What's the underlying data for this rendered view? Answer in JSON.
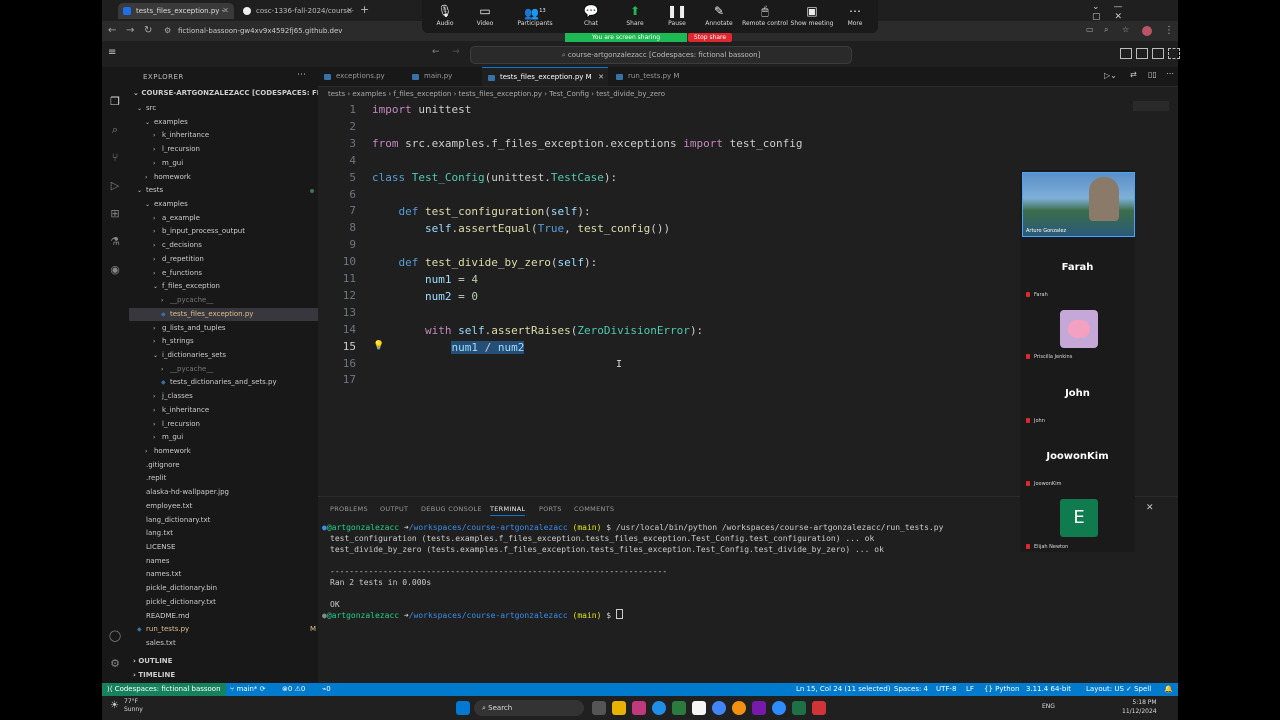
{
  "browser": {
    "tabs": [
      {
        "label": "tests_files_exception.py - cours",
        "active": true
      },
      {
        "label": "cosc-1336-fall-2024/course-art",
        "active": false
      }
    ],
    "url": "fictional-bassoon-gw4xv9x4592fj65.github.dev"
  },
  "zoom_bar": {
    "buttons": [
      {
        "label": "Audio",
        "icon": "microphone-icon"
      },
      {
        "label": "Video",
        "icon": "video-icon"
      },
      {
        "label": "Participants",
        "icon": "participants-icon",
        "count": "13"
      },
      {
        "label": "Chat",
        "icon": "chat-icon"
      },
      {
        "label": "Share",
        "icon": "share-icon"
      },
      {
        "label": "Pause",
        "icon": "pause-icon"
      },
      {
        "label": "Annotate",
        "icon": "annotate-icon"
      },
      {
        "label": "Remote control",
        "icon": "remote-control-icon"
      },
      {
        "label": "Show meeting",
        "icon": "show-meeting-icon"
      },
      {
        "label": "More",
        "icon": "more-icon"
      }
    ],
    "sharing_text": "You are screen sharing",
    "stop_share": "Stop share"
  },
  "vscode": {
    "command_center": "course-artgonzalezacc [Codespaces: fictional bassoon]",
    "explorer_title": "EXPLORER",
    "workspace_title": "COURSE-ARTGONZALEZACC [CODESPACES: FICTIO...",
    "tree": [
      {
        "label": "src",
        "indent": 1,
        "type": "folder-open"
      },
      {
        "label": "examples",
        "indent": 2,
        "type": "folder-open"
      },
      {
        "label": "k_inheritance",
        "indent": 3,
        "type": "folder"
      },
      {
        "label": "l_recursion",
        "indent": 3,
        "type": "folder"
      },
      {
        "label": "m_gui",
        "indent": 3,
        "type": "folder"
      },
      {
        "label": "homework",
        "indent": 2,
        "type": "folder"
      },
      {
        "label": "tests",
        "indent": 1,
        "type": "folder-open",
        "modified": true
      },
      {
        "label": "examples",
        "indent": 2,
        "type": "folder-open",
        "modified": true
      },
      {
        "label": "a_example",
        "indent": 3,
        "type": "folder"
      },
      {
        "label": "b_input_process_output",
        "indent": 3,
        "type": "folder"
      },
      {
        "label": "c_decisions",
        "indent": 3,
        "type": "folder"
      },
      {
        "label": "d_repetition",
        "indent": 3,
        "type": "folder"
      },
      {
        "label": "e_functions",
        "indent": 3,
        "type": "folder"
      },
      {
        "label": "f_files_exception",
        "indent": 3,
        "type": "folder-open",
        "modified": true
      },
      {
        "label": "__pycache__",
        "indent": 4,
        "type": "folder",
        "dim": true
      },
      {
        "label": "tests_files_exception.py",
        "indent": 4,
        "type": "file",
        "badge": "M",
        "selected": true
      },
      {
        "label": "g_lists_and_tuples",
        "indent": 3,
        "type": "folder"
      },
      {
        "label": "h_strings",
        "indent": 3,
        "type": "folder"
      },
      {
        "label": "i_dictionaries_sets",
        "indent": 3,
        "type": "folder-open"
      },
      {
        "label": "__pycache__",
        "indent": 4,
        "type": "folder",
        "dim": true
      },
      {
        "label": "tests_dictionaries_and_sets.py",
        "indent": 4,
        "type": "file"
      },
      {
        "label": "j_classes",
        "indent": 3,
        "type": "folder"
      },
      {
        "label": "k_inheritance",
        "indent": 3,
        "type": "folder"
      },
      {
        "label": "l_recursion",
        "indent": 3,
        "type": "folder"
      },
      {
        "label": "m_gui",
        "indent": 3,
        "type": "folder"
      },
      {
        "label": "homework",
        "indent": 2,
        "type": "folder"
      },
      {
        "label": ".gitignore",
        "indent": 1,
        "type": "file"
      },
      {
        "label": ".replit",
        "indent": 1,
        "type": "file"
      },
      {
        "label": "alaska-hd-wallpaper.jpg",
        "indent": 1,
        "type": "file"
      },
      {
        "label": "employee.txt",
        "indent": 1,
        "type": "file"
      },
      {
        "label": "lang_dictionary.txt",
        "indent": 1,
        "type": "file"
      },
      {
        "label": "lang.txt",
        "indent": 1,
        "type": "file"
      },
      {
        "label": "LICENSE",
        "indent": 1,
        "type": "file"
      },
      {
        "label": "names",
        "indent": 1,
        "type": "file"
      },
      {
        "label": "names.txt",
        "indent": 1,
        "type": "file"
      },
      {
        "label": "pickle_dictionary.bin",
        "indent": 1,
        "type": "file"
      },
      {
        "label": "pickle_dictionary.txt",
        "indent": 1,
        "type": "file"
      },
      {
        "label": "README.md",
        "indent": 1,
        "type": "file"
      },
      {
        "label": "run_tests.py",
        "indent": 1,
        "type": "file",
        "badge": "M"
      },
      {
        "label": "sales.txt",
        "indent": 1,
        "type": "file"
      }
    ],
    "outline": "OUTLINE",
    "timeline": "TIMELINE",
    "editor_tabs": [
      {
        "label": "exceptions.py",
        "active": false
      },
      {
        "label": "main.py",
        "active": false
      },
      {
        "label": "tests_files_exception.py M",
        "active": true
      },
      {
        "label": "run_tests.py M",
        "active": false
      }
    ],
    "breadcrumb": "tests › examples › f_files_exception › tests_files_exception.py › Test_Config › test_divide_by_zero",
    "code_lines": [
      "1",
      "2",
      "3",
      "4",
      "5",
      "6",
      "7",
      "8",
      "9",
      "10",
      "11",
      "12",
      "13",
      "14",
      "15",
      "16",
      "17"
    ],
    "panel_tabs": [
      "PROBLEMS",
      "OUTPUT",
      "DEBUG CONSOLE",
      "TERMINAL",
      "PORTS",
      "COMMENTS"
    ],
    "terminal": {
      "prompt_user": "@artgonzalezacc",
      "prompt_path": "/workspaces/course-artgonzalezacc",
      "branch": "(main)",
      "command": "$ /usr/local/bin/python /workspaces/course-artgonzalezacc/run_tests.py",
      "line1": "test_configuration (tests.examples.f_files_exception.tests_files_exception.Test_Config.test_configuration) ... ok",
      "line2": "test_divide_by_zero (tests.examples.f_files_exception.tests_files_exception.Test_Config.test_divide_by_zero) ... ok",
      "separator": "----------------------------------------------------------------------",
      "ran": "Ran 2 tests in 0.000s",
      "ok": "OK",
      "prompt_end": "$"
    },
    "status": {
      "remote": "Codespaces: fictional bassoon",
      "branch": "main*",
      "errors": "0",
      "warnings": "0",
      "ports": "0",
      "position": "Ln 15, Col 24 (11 selected)",
      "spaces": "Spaces: 4",
      "encoding": "UTF-8",
      "eol": "LF",
      "language": "Python",
      "interpreter": "3.11.4 64-bit",
      "layout": "Layout: US",
      "spell": "Spell"
    }
  },
  "participants": [
    {
      "name": "Arturo Gonzalez",
      "type": "video"
    },
    {
      "name": "Farah",
      "display": "Farah",
      "type": "name"
    },
    {
      "name": "Priscilla Jenkins",
      "type": "avatar"
    },
    {
      "name": "John",
      "display": "John",
      "type": "name"
    },
    {
      "name": "JoowonKim",
      "display": "JoowonKim",
      "type": "name"
    },
    {
      "name": "Elijah Newton",
      "display": "E",
      "type": "initial"
    }
  ],
  "taskbar": {
    "weather_temp": "77°F",
    "weather_desc": "Sunny",
    "search": "Search",
    "lang": "ENG",
    "time": "5:18 PM",
    "date": "11/12/2024"
  }
}
